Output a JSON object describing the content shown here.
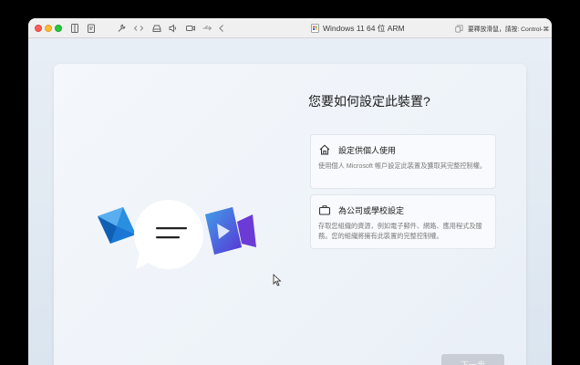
{
  "window": {
    "title": "Windows 11 64 位 ARM",
    "hint": "要釋放滑鼠，請按: Control-⌘"
  },
  "toolbar": {
    "icons": [
      "sidebar-icon",
      "clipboard-icon",
      "wrench-icon",
      "code-arrows-icon",
      "drive-icon",
      "speaker-icon",
      "camera-icon",
      "usb-icon",
      "back-chevron-icon"
    ]
  },
  "setup": {
    "heading": "您要如何設定此裝置?",
    "options": [
      {
        "icon": "home-icon",
        "title": "設定供個人使用",
        "description": "使用個人 Microsoft 帳戶設定此裝置及獲取其完整控制權。"
      },
      {
        "icon": "briefcase-icon",
        "title": "為公司或學校設定",
        "description": "存取您組織的資源，例如電子郵件、網路、應用程式及服務。您的組織將擁有此裝置的完整控制權。"
      }
    ],
    "next_label": "下一步"
  },
  "colors": {
    "mail_blue": "#1a78d4",
    "video_purple": "#4b4fd9",
    "button_disabled": "#c9ced6"
  }
}
